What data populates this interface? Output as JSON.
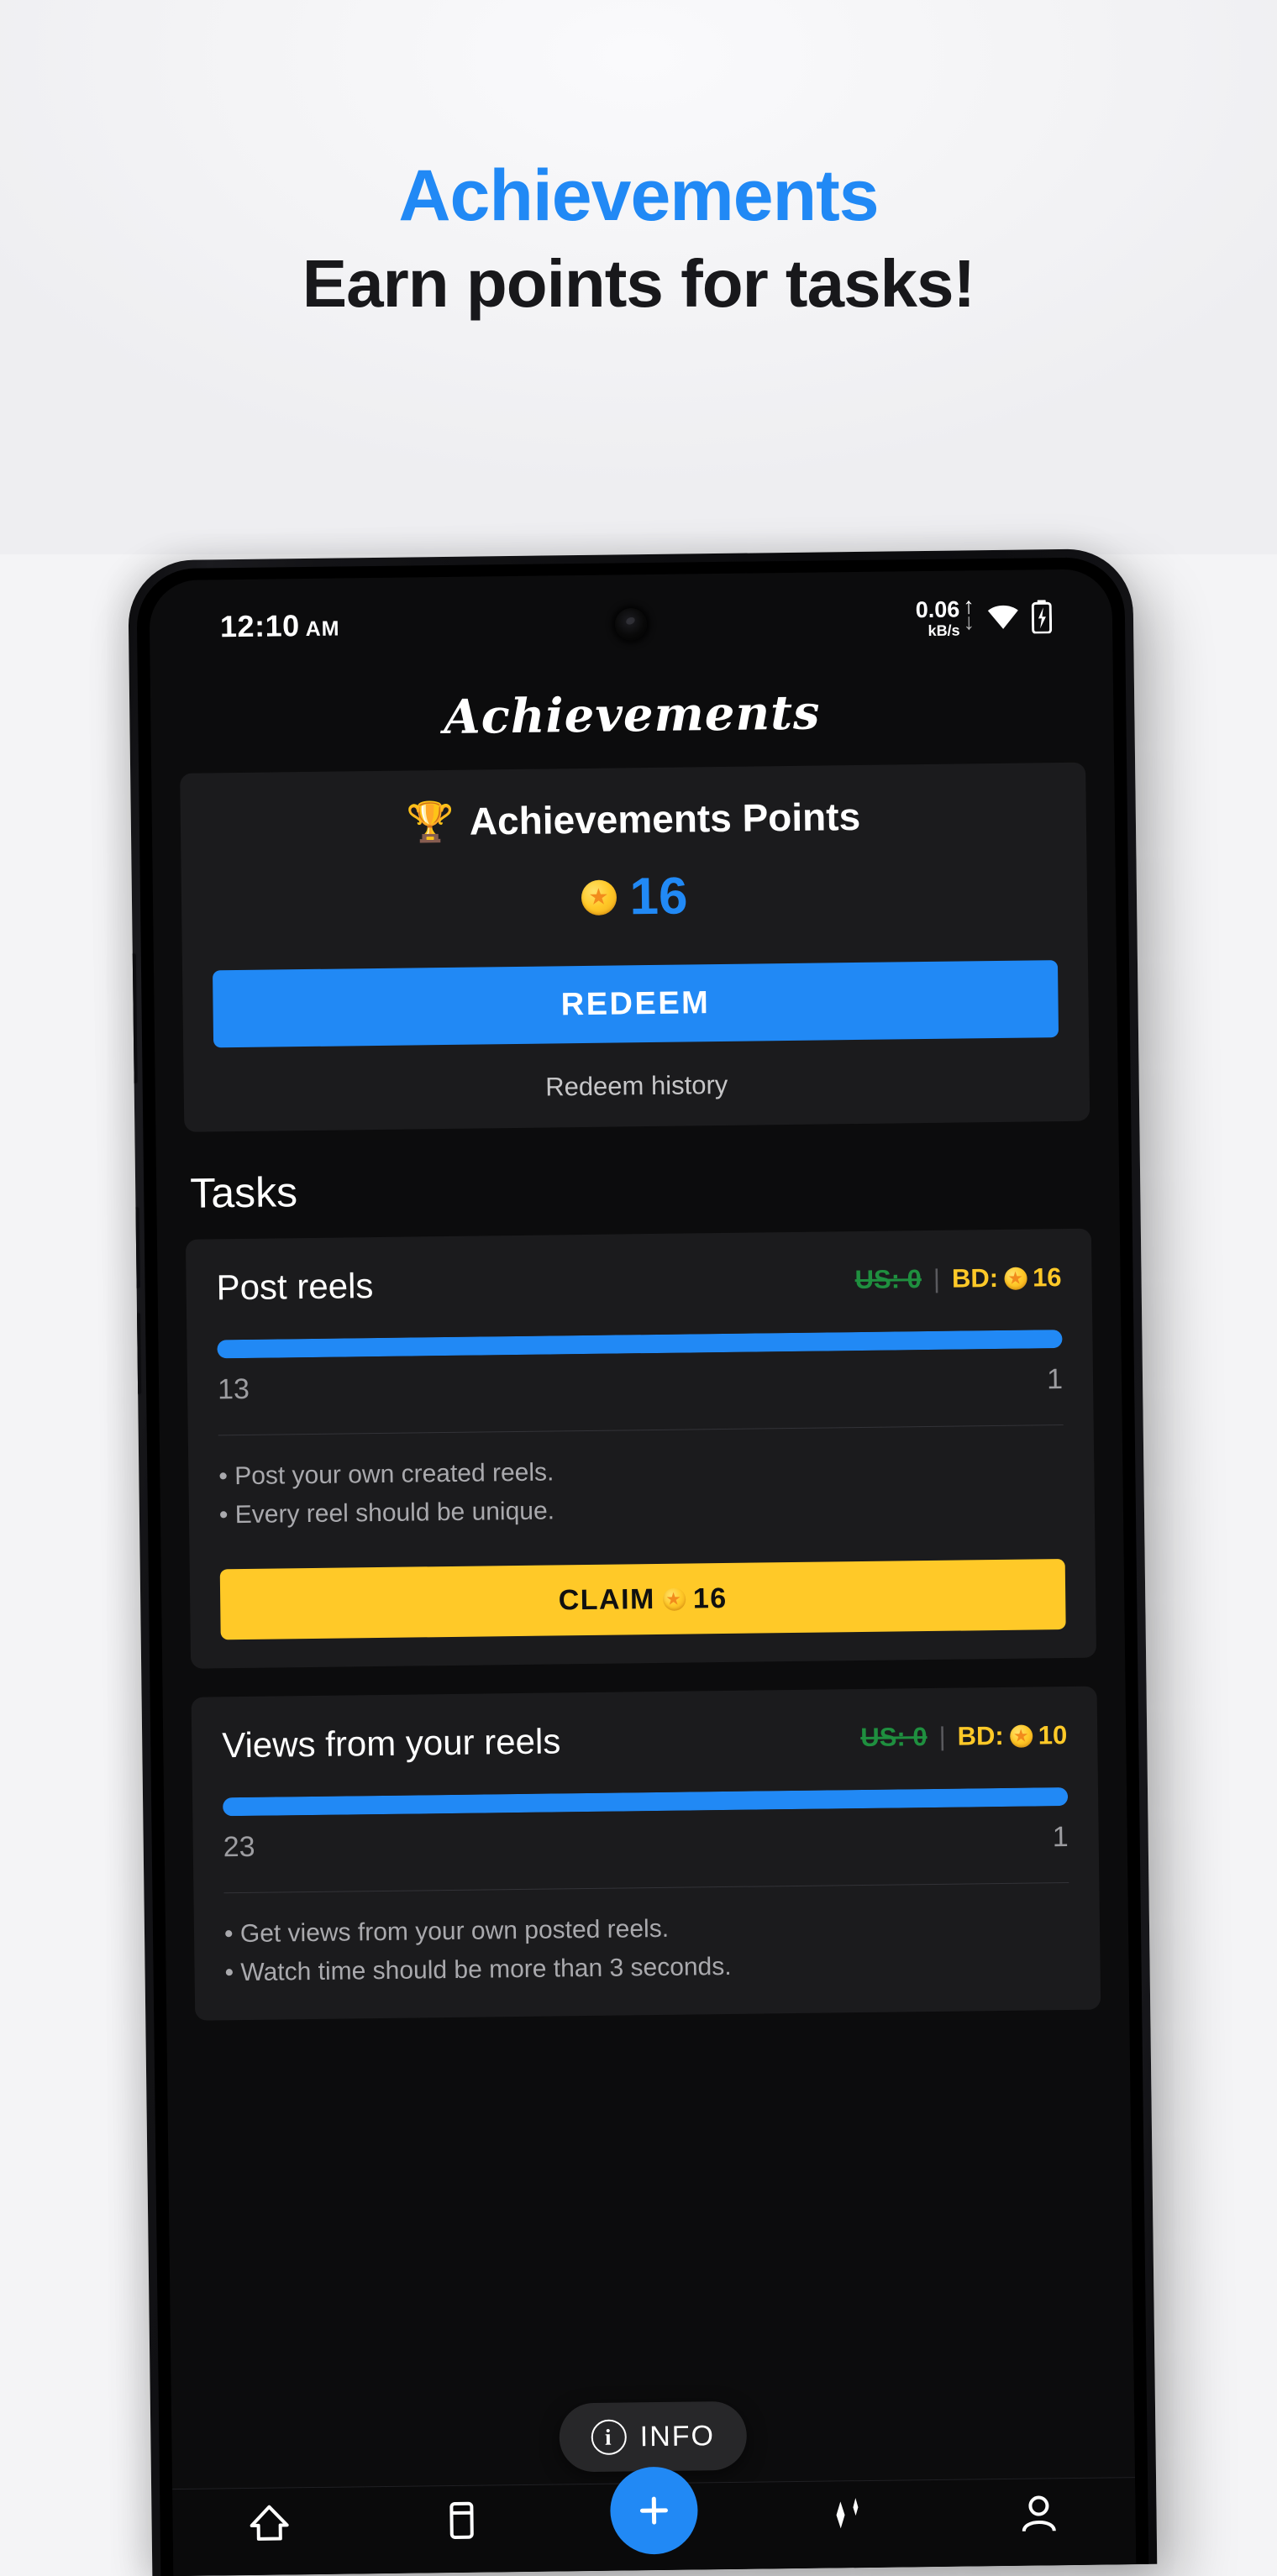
{
  "promo": {
    "line1": "Achievements",
    "line2": "Earn points for tasks!",
    "accent_color": "#2189f5",
    "text_color": "#18181b",
    "background_color": "#f4f4f6"
  },
  "statusbar": {
    "time": "12:10",
    "ampm": "AM",
    "net_speed": "0.06",
    "net_unit": "kB/s",
    "up_arrow": "↑",
    "down_arrow": "↓"
  },
  "app": {
    "title": "Achievements"
  },
  "points_card": {
    "trophy": "🏆",
    "heading": "Achievements Points",
    "coin_glyph": "★",
    "value": "16",
    "value_color": "#2189f5",
    "redeem_label": "REDEEM",
    "redeem_button_color": "#2189f5",
    "history_label": "Redeem history"
  },
  "tasks": {
    "section_title": "Tasks",
    "items": [
      {
        "name": "Post reels",
        "reward_us_label": "US: 0",
        "reward_separator": "|",
        "reward_bd_label": "BD:",
        "reward_bd_value": "16",
        "progress_percent": 100,
        "progress_left": "13",
        "progress_right": "1",
        "bullets": [
          "• Post your own created reels.",
          "• Every reel should be unique."
        ],
        "claim_label": "CLAIM",
        "claim_value": "16",
        "claim_color": "#ffc928"
      },
      {
        "name": "Views from your reels",
        "reward_us_label": "US: 0",
        "reward_separator": "|",
        "reward_bd_label": "BD:",
        "reward_bd_value": "10",
        "progress_percent": 100,
        "progress_left": "23",
        "progress_right": "1",
        "bullets": [
          "• Get views from your own posted reels.",
          "• Watch time should be more than 3 seconds."
        ]
      }
    ]
  },
  "info_fab": {
    "icon_glyph": "i",
    "label": "INFO"
  },
  "bottom_nav": {
    "items": [
      {
        "icon": "home-icon"
      },
      {
        "icon": "reels-icon"
      },
      {
        "icon": "add-icon"
      },
      {
        "icon": "sparkle-icon"
      },
      {
        "icon": "profile-icon"
      }
    ]
  }
}
